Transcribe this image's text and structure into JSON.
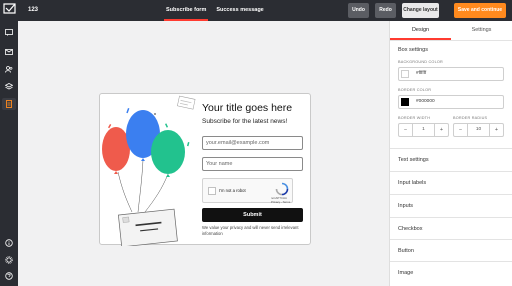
{
  "header": {
    "title": "123",
    "tabs": [
      "Subscribe form",
      "Success message"
    ],
    "undo_label": "Undo",
    "redo_label": "Redo",
    "change_layout_label": "Change layout",
    "save_label": "Save and continue"
  },
  "sidebar": {
    "icons": [
      "logo-icon",
      "chat-icon",
      "send-icon",
      "users-icon",
      "layers-icon",
      "forms-icon",
      "info-icon",
      "settings-icon",
      "help-icon"
    ],
    "active": "forms-icon"
  },
  "form": {
    "title": "Your title goes here",
    "subtitle": "Subscribe for the latest news!",
    "email_placeholder": "your.email@example.com",
    "name_placeholder": "Your name",
    "captcha_label": "I'm not a robot",
    "captcha_brand": "reCAPTCHA",
    "captcha_terms": "Privacy - Terms",
    "submit_label": "Submit",
    "privacy_text": "We value your privacy and will never send irrelevant information"
  },
  "panel": {
    "tabs": [
      "Design",
      "Settings"
    ],
    "active_tab": "Design",
    "section_title": "Box settings",
    "background_color_label": "BACKGROUND COLOR",
    "background_color_value": "#ffffff",
    "border_color_label": "BORDER COLOR",
    "border_color_value": "#000000",
    "border_width_label": "BORDER WIDTH",
    "border_width_value": "1",
    "border_radius_label": "BORDER RADIUS",
    "border_radius_value": "10",
    "minus": "−",
    "plus": "+",
    "sections": [
      "Text settings",
      "Input labels",
      "Inputs",
      "Checkbox",
      "Button",
      "Image"
    ]
  },
  "colors": {
    "accent": "#ff3b30",
    "save_button": "#ff8a1e",
    "dark_bar": "#2b2d33",
    "balloon_red": "#ef5b4c",
    "balloon_blue": "#3b7ff0",
    "balloon_green": "#22c28e"
  }
}
